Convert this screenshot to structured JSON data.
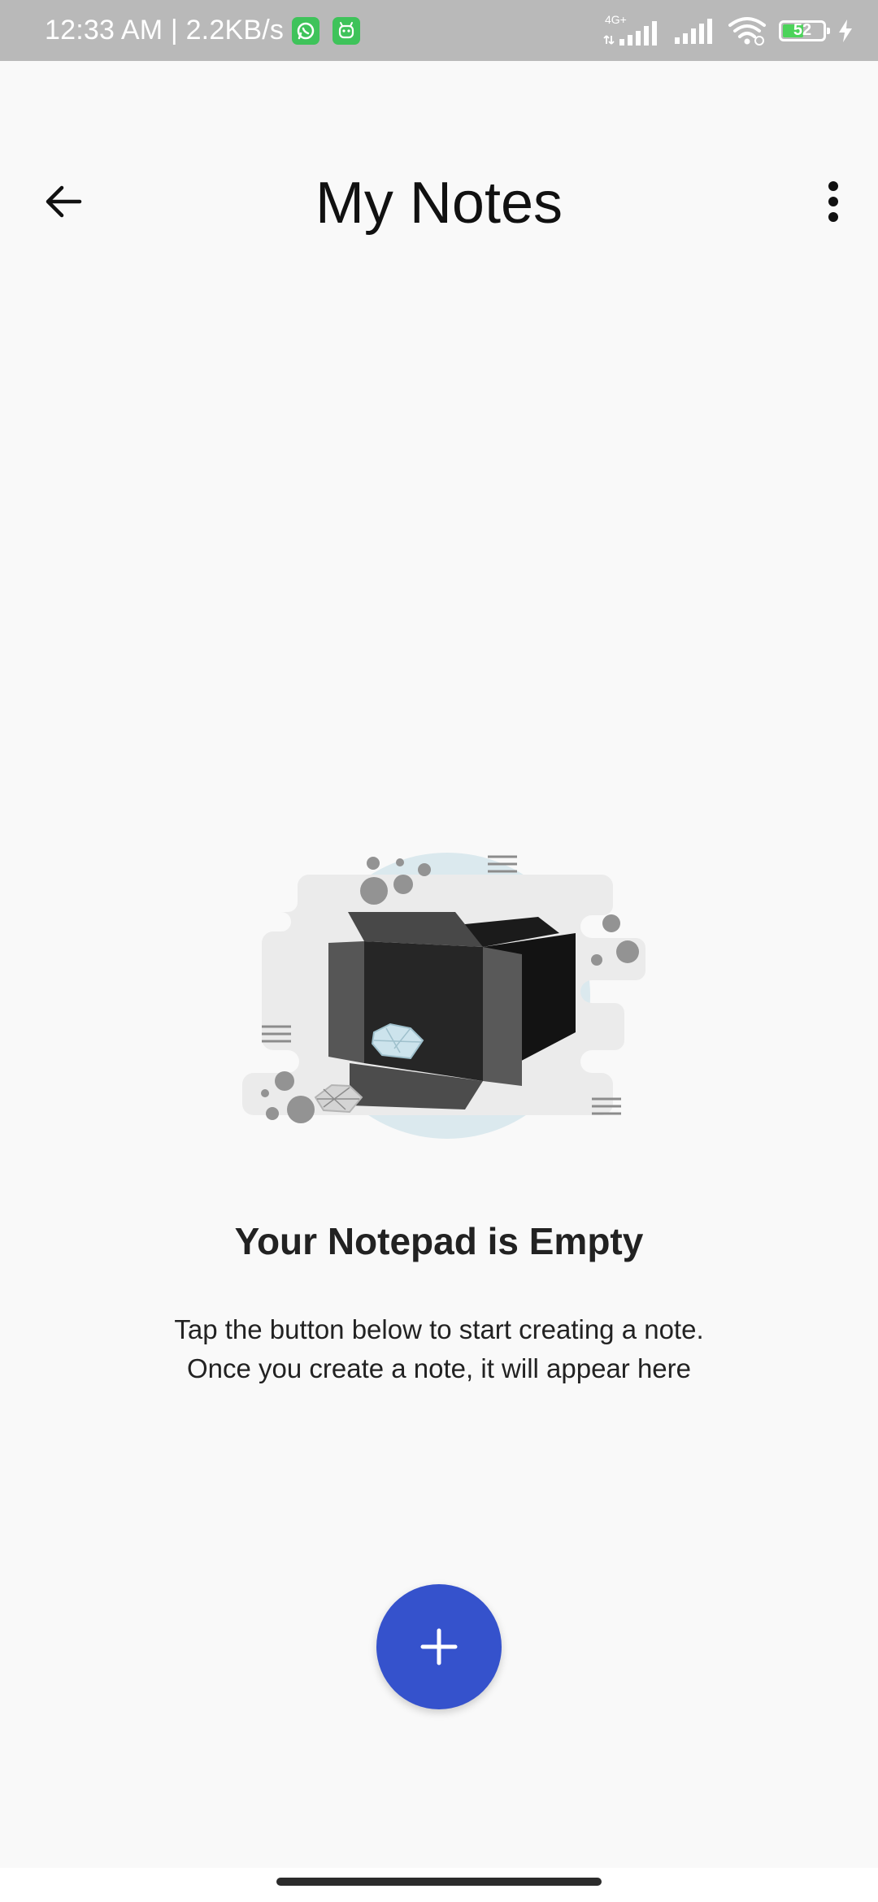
{
  "status_bar": {
    "time_speed": "12:33 AM | 2.2KB/s",
    "network_label": "4G+",
    "battery_level": "52",
    "battery_fraction": 0.52,
    "icons": [
      "whatsapp-icon",
      "notification-app-icon",
      "signal-4g-icon",
      "signal-icon",
      "wifi-icon",
      "battery-icon",
      "charging-icon"
    ]
  },
  "header": {
    "title": "My Notes",
    "back_icon": "arrow-left-icon",
    "menu_icon": "more-vertical-icon"
  },
  "empty_state": {
    "illustration": "empty-box-illustration",
    "title": "Your Notepad is Empty",
    "description": "Tap the button below to start creating a note. Once you create a note, it will appear here"
  },
  "fab": {
    "icon": "plus-icon",
    "color": "#3552cc"
  },
  "colors": {
    "background": "#f9f9f9",
    "status_bar": "#b9b9b9",
    "accent": "#3552cc"
  }
}
